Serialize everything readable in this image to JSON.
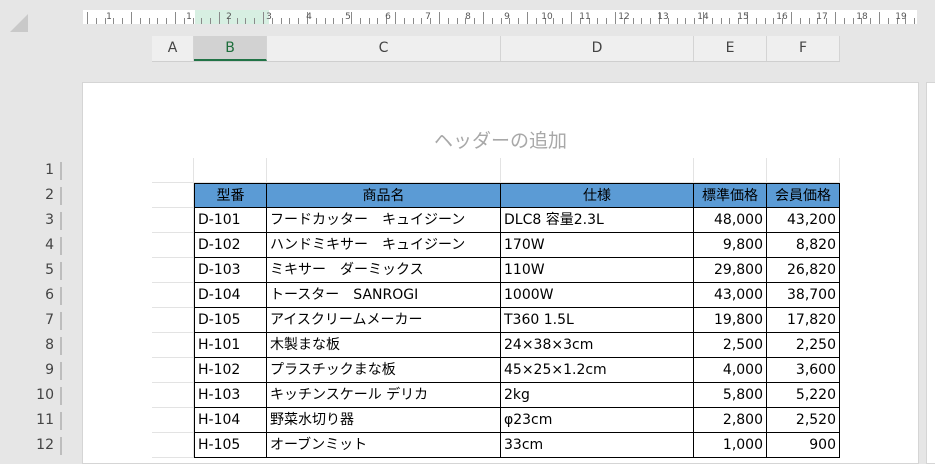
{
  "ruler": {
    "labels": [
      "1",
      "1",
      "2",
      "3",
      "4",
      "5",
      "6",
      "7",
      "8",
      "9",
      "10",
      "11",
      "12",
      "13",
      "14",
      "15",
      "16",
      "17",
      "18",
      "19"
    ]
  },
  "columns": [
    "A",
    "B",
    "C",
    "D",
    "E",
    "F"
  ],
  "selected_column": "B",
  "page_header_placeholder": "ヘッダーの追加",
  "row_numbers": [
    "1",
    "2",
    "3",
    "4",
    "5",
    "6",
    "7",
    "8",
    "9",
    "10",
    "11",
    "12"
  ],
  "table": {
    "headers": [
      "型番",
      "商品名",
      "仕様",
      "標準価格",
      "会員価格"
    ],
    "rows": [
      [
        "D-101",
        "フードカッター　キュイジーン",
        "DLC8 容量2.3L",
        "48,000",
        "43,200"
      ],
      [
        "D-102",
        "ハンドミキサー　キュイジーン",
        "170W",
        "9,800",
        "8,820"
      ],
      [
        "D-103",
        "ミキサー　ダーミックス",
        "110W",
        "29,800",
        "26,820"
      ],
      [
        "D-104",
        "トースター　SANROGI",
        "1000W",
        "43,000",
        "38,700"
      ],
      [
        "D-105",
        "アイスクリームメーカー",
        "T360 1.5L",
        "19,800",
        "17,820"
      ],
      [
        "H-101",
        "木製まな板",
        "24×38×3cm",
        "2,500",
        "2,250"
      ],
      [
        "H-102",
        "プラスチックまな板",
        "45×25×1.2cm",
        "4,000",
        "3,600"
      ],
      [
        "H-103",
        "キッチンスケール デリカ",
        "2kg",
        "5,800",
        "5,220"
      ],
      [
        "H-104",
        "野菜水切り器",
        "φ23cm",
        "2,800",
        "2,520"
      ],
      [
        "H-105",
        "オーブンミット",
        "33cm",
        "1,000",
        "900"
      ]
    ]
  },
  "colors": {
    "header_fill": "#5b9bd5",
    "selection": "#217346",
    "placeholder_text": "#a8a8a8"
  }
}
